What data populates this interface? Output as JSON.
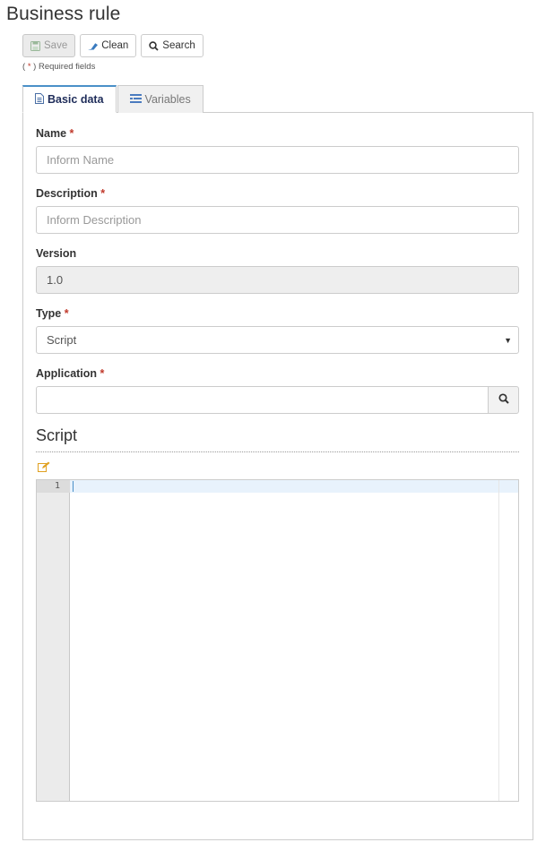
{
  "page": {
    "title": "Business rule"
  },
  "toolbar": {
    "save_label": "Save",
    "clean_label": "Clean",
    "search_label": "Search"
  },
  "required_note": {
    "prefix": "( ",
    "star": "*",
    "suffix": " ) Required fields"
  },
  "tabs": [
    {
      "label": "Basic data",
      "icon": "document-icon",
      "active": true
    },
    {
      "label": "Variables",
      "icon": "list-icon",
      "active": false
    }
  ],
  "form": {
    "name": {
      "label": "Name",
      "star": "*",
      "placeholder": "Inform Name"
    },
    "description": {
      "label": "Description",
      "star": "*",
      "placeholder": "Inform Description"
    },
    "version": {
      "label": "Version",
      "value": "1.0"
    },
    "type": {
      "label": "Type",
      "star": "*",
      "value": "Script"
    },
    "application": {
      "label": "Application",
      "star": "*",
      "value": ""
    }
  },
  "script": {
    "title": "Script",
    "line_numbers": [
      "1"
    ],
    "content": ""
  },
  "colors": {
    "required_star": "#c0392b",
    "tab_accent": "#4a90c8",
    "active_tab_text": "#1f2d5a",
    "edit_icon": "#e0a020"
  }
}
